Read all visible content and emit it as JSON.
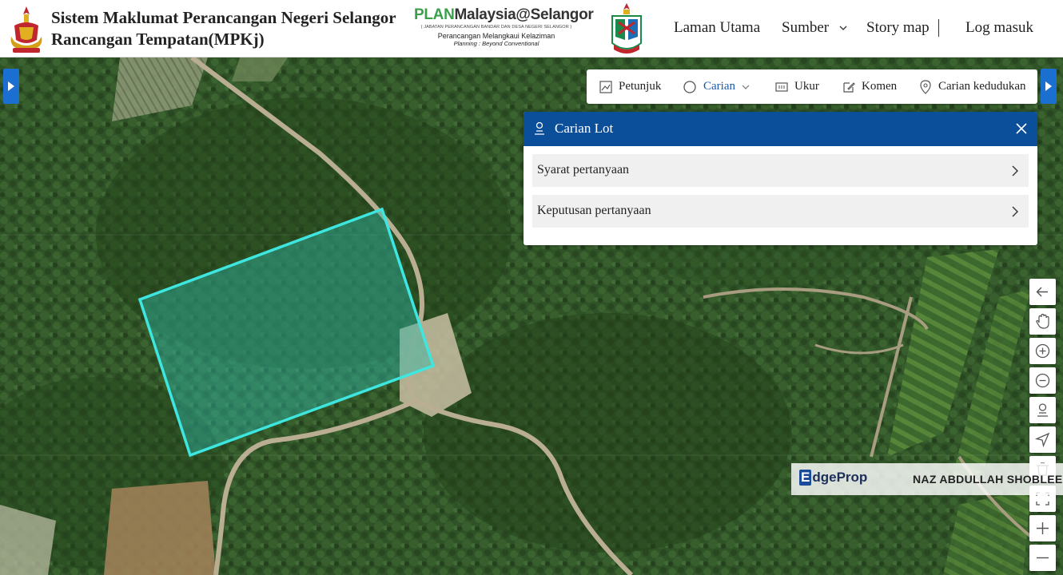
{
  "header": {
    "title_line1": "Sistem Maklumat Perancangan Negeri Selangor",
    "title_line2": "Rancangan Tempatan(MPKj)",
    "plan_logo": {
      "brand_a": "PLAN",
      "brand_b": "Malaysia@Selangor",
      "subtitle": "( JABATAN PERANCANGAN BANDAR DAN DESA NEGERI SELANGOR )",
      "tagline": "Perancangan Melangkaui Kelaziman",
      "tagline2": "Planning : Beyond Conventional"
    },
    "nav": {
      "home": "Laman Utama",
      "resources": "Sumber",
      "story_map": "Story map",
      "login": "Log masuk"
    }
  },
  "toolbar": {
    "items": [
      {
        "label": "Petunjuk",
        "icon": "legend-icon"
      },
      {
        "label": "Carian",
        "icon": "search-icon",
        "active": true
      },
      {
        "label": "Ukur",
        "icon": "measure-icon"
      },
      {
        "label": "Komen",
        "icon": "comment-icon"
      },
      {
        "label": "Carian kedudukan",
        "icon": "location-pin-icon"
      }
    ]
  },
  "panel": {
    "title": "Carian Lot",
    "rows": [
      {
        "label": "Syarat pertanyaan"
      },
      {
        "label": "Keputusan pertanyaan"
      }
    ]
  },
  "map_controls": [
    "back-arrow-icon",
    "pan-hand-icon",
    "zoom-in-icon",
    "zoom-out-icon",
    "person-icon",
    "navigate-icon",
    "clear-icon",
    "fullscreen-icon",
    "plus-icon",
    "minus-icon"
  ],
  "watermark": {
    "brand": "dgeProp",
    "brand_initial": "E",
    "agent": "NAZ ABDULLAH SHOBLEE"
  },
  "colors": {
    "header_bg": "#ffffff",
    "panel_header": "#0b4e9a",
    "accent_blue": "#1b6fd0",
    "lot_outline": "#3ee6e0"
  }
}
